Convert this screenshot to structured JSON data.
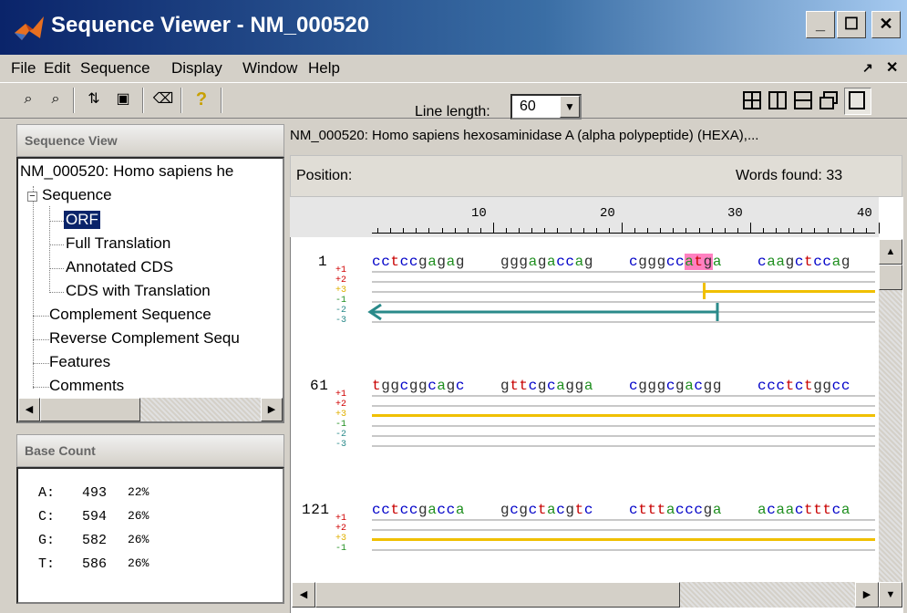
{
  "window": {
    "title": "Sequence Viewer - NM_000520"
  },
  "menu": [
    "File",
    "Edit",
    "Sequence",
    "Display",
    "Window",
    "Help"
  ],
  "toolbar": {
    "line_length_label": "Line length:",
    "line_length_value": "60"
  },
  "left_panel": {
    "header": "Sequence View",
    "tree": {
      "root": "NM_000520: Homo sapiens he",
      "sequence": "Sequence",
      "children": [
        "ORF",
        "Full Translation",
        "Annotated CDS",
        "CDS with Translation"
      ],
      "others": [
        "Complement Sequence",
        "Reverse Complement Sequ",
        "Features",
        "Comments"
      ]
    }
  },
  "base_count": {
    "header": "Base Count",
    "rows": [
      {
        "base": "A:",
        "count": "493",
        "pct": "22%"
      },
      {
        "base": "C:",
        "count": "594",
        "pct": "26%"
      },
      {
        "base": "G:",
        "count": "582",
        "pct": "26%"
      },
      {
        "base": "T:",
        "count": "586",
        "pct": "26%"
      }
    ]
  },
  "main": {
    "description": "NM_000520: Homo sapiens hexosaminidase A (alpha polypeptide) (HEXA),...",
    "position_label": "Position:",
    "words_found": "Words found: 33",
    "ruler": [
      "10",
      "20",
      "30",
      "40"
    ],
    "blocks": [
      {
        "pos": "1",
        "seq": [
          "cctccgagag",
          "gggagaccag",
          "cgggccatga",
          "caagctccag"
        ]
      },
      {
        "pos": "61",
        "seq": [
          "tggcggcagc",
          "gttcgcagga",
          "cgggcgacgg",
          "ccctctggcc"
        ]
      },
      {
        "pos": "121",
        "seq": [
          "cctccgacca",
          "gcgctacgtc",
          "ctttacccga",
          "acaactttca"
        ]
      }
    ],
    "frames": [
      "+1",
      "+2",
      "+3",
      "-1",
      "-2",
      "-3"
    ]
  },
  "colors": {
    "a": "#1f8f1f",
    "c": "#0000c8",
    "g": "#303030",
    "t": "#c80000",
    "orf": "#f0c000",
    "reverse_orf": "#2a8a8a",
    "highlight": "#ff80c0"
  }
}
